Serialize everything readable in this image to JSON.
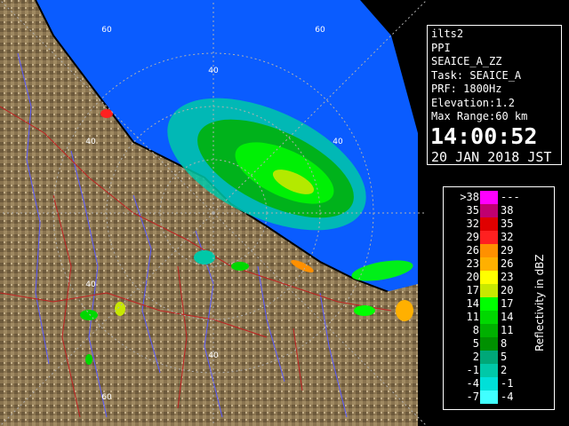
{
  "info": {
    "site": "ilts2",
    "scan": "PPI",
    "product": "SEAICE_A_ZZ",
    "task": "Task: SEAICE_A",
    "prf": "PRF: 1800Hz",
    "elevation": "Elevation:1.2",
    "max_range": "Max Range:60 km",
    "time": "14:00:52",
    "date": "20 JAN 2018 JST"
  },
  "range_labels": [
    "60",
    "40",
    "40",
    "40",
    "40",
    "60",
    "40",
    "60"
  ],
  "legend": {
    "title": "Reflectivity in dBZ",
    "rows": [
      {
        "lo": ">38",
        "hi": "---",
        "color": "#ff00ff"
      },
      {
        "lo": "35",
        "hi": "38",
        "color": "#c00070"
      },
      {
        "lo": "32",
        "hi": "35",
        "color": "#e00000"
      },
      {
        "lo": "29",
        "hi": "32",
        "color": "#ff2020"
      },
      {
        "lo": "26",
        "hi": "29",
        "color": "#ff9000"
      },
      {
        "lo": "23",
        "hi": "26",
        "color": "#ffb000"
      },
      {
        "lo": "20",
        "hi": "23",
        "color": "#ffff00"
      },
      {
        "lo": "17",
        "hi": "20",
        "color": "#c8e800"
      },
      {
        "lo": "14",
        "hi": "17",
        "color": "#00ff00"
      },
      {
        "lo": "11",
        "hi": "14",
        "color": "#00d800"
      },
      {
        "lo": "8",
        "hi": "11",
        "color": "#00b000"
      },
      {
        "lo": "5",
        "hi": "8",
        "color": "#009000"
      },
      {
        "lo": "2",
        "hi": "5",
        "color": "#00a878"
      },
      {
        "lo": "-1",
        "hi": "2",
        "color": "#00c8a8"
      },
      {
        "lo": "-4",
        "hi": "-1",
        "color": "#00e0d8"
      },
      {
        "lo": "-7",
        "hi": "-4",
        "color": "#40ffff"
      }
    ]
  },
  "colors": {
    "sea": "#0a5cff",
    "land": "#8a7450",
    "river": "#5a5aff",
    "road": "#c02020",
    "coast": "#000000"
  }
}
